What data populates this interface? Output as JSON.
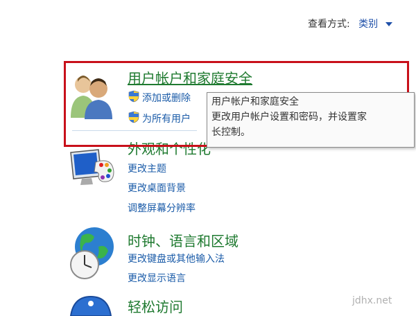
{
  "view_by": {
    "label": "查看方式:",
    "value": "类别"
  },
  "categories": [
    {
      "title": "用户帐户和家庭安全",
      "links": [
        "添加或删除用户帐户",
        "为所有用户设置家长控制"
      ],
      "icon": "users-icon"
    },
    {
      "title": "外观和个性化",
      "links": [
        "更改主题",
        "更改桌面背景",
        "调整屏幕分辨率"
      ],
      "icon": "display-palette-icon"
    },
    {
      "title": "时钟、语言和区域",
      "links": [
        "更改键盘或其他输入法",
        "更改显示语言"
      ],
      "icon": "globe-clock-icon"
    },
    {
      "title": "轻松访问",
      "links": [],
      "icon": "ease-of-access-icon"
    }
  ],
  "tooltip": {
    "line1": "用户帐户和家庭安全",
    "line2": "更改用户帐户设置和密码，并设置家",
    "line3": "长控制。"
  },
  "visible_links_truncated": [
    "添加或删除",
    "为所有用户"
  ],
  "visible_title_partial": "外观和个性化",
  "watermark": "jdhx.net",
  "colors": {
    "highlight": "#c8101a",
    "title": "#1f7a30",
    "link": "#1a5ba8"
  }
}
